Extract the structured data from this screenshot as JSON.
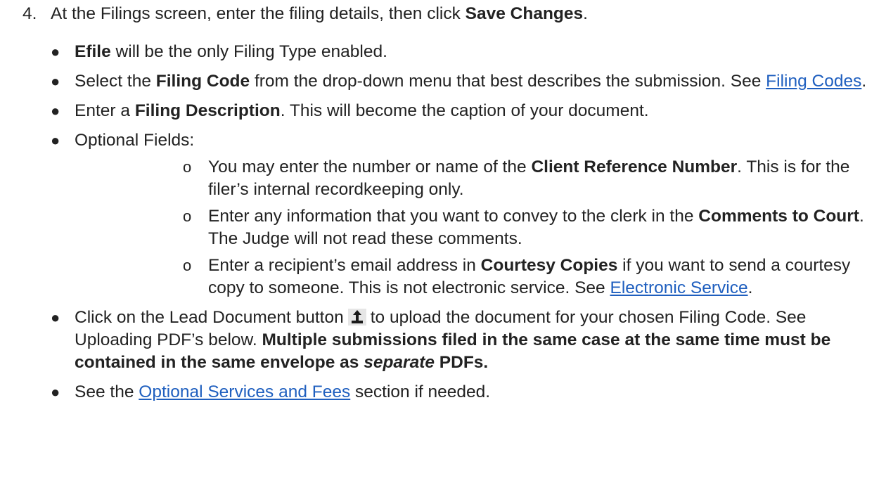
{
  "step": {
    "number": "4.",
    "text_before": "At the Filings screen, enter the filing details, then click ",
    "save_label": "Save Changes",
    "text_after": "."
  },
  "bullets": {
    "b1": {
      "bold": "Efile",
      "text": " will be the only Filing Type enabled."
    },
    "b2": {
      "text1": "Select the ",
      "bold": "Filing Code",
      "text2": " from the drop-down menu that best describes the submission. See ",
      "link": "Filing Codes",
      "text3": "."
    },
    "b3": {
      "text1": "Enter a ",
      "bold": "Filing Description",
      "text2": ". This will become the caption of your document."
    },
    "b4": {
      "label": "Optional Fields:",
      "sub1": {
        "text1": "You may enter the number or name of the ",
        "bold": "Client Reference Number",
        "text2": ". This is for the filer’s internal recordkeeping only."
      },
      "sub2": {
        "text1": "Enter any information that you want to convey to the clerk in the ",
        "bold": "Comments to Court",
        "text2": ". The Judge will not read these comments."
      },
      "sub3": {
        "text1": "Enter a recipient’s email address in ",
        "bold": "Courtesy Copies",
        "text2": " if you want to send a courtesy copy to someone. This is not electronic service. See ",
        "link": "Electronic Service",
        "text3": "."
      }
    },
    "b5": {
      "text1": "Click on the Lead Document button",
      "icon": "upload-icon",
      "text2": "to upload the document for your chosen Filing Code. See Uploading PDF’s below. ",
      "bold1": "Multiple submissions filed in the same case at the same time must be contained in the same envelope as ",
      "bold_italic": "separate",
      "bold2": " PDFs."
    },
    "b6": {
      "text1": "See the ",
      "link": "Optional Services and Fees",
      "text2": " section if needed."
    }
  },
  "colors": {
    "link": "#1f5fbf",
    "text": "#222222"
  }
}
